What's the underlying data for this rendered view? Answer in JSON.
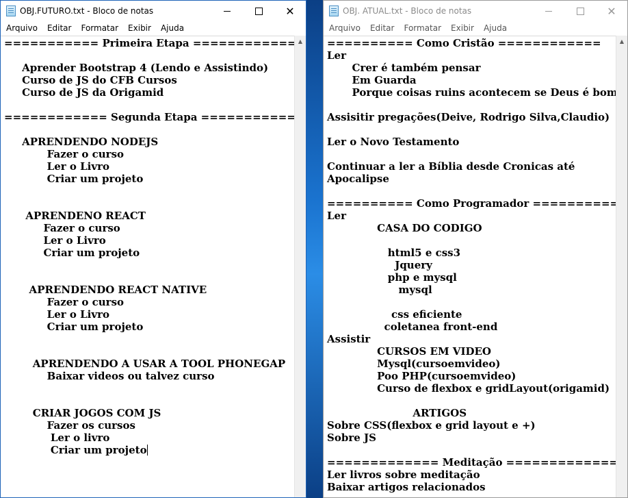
{
  "left_window": {
    "title": "OBJ.FUTURO.txt - Bloco de notas",
    "icon": "notepad-icon",
    "menu": [
      "Arquivo",
      "Editar",
      "Formatar",
      "Exibir",
      "Ajuda"
    ],
    "lines": [
      "=========== Primeira Etapa =============",
      "",
      "     Aprender Bootstrap 4 (Lendo e Assistindo)",
      "     Curso de JS do CFB Cursos",
      "     Curso de JS da Origamid",
      "",
      "============ Segunda Etapa =============",
      "",
      "     APRENDENDO NODEJS",
      "            Fazer o curso",
      "            Ler o Livro",
      "            Criar um projeto",
      "",
      "",
      "      APRENDENO REACT",
      "           Fazer o curso",
      "           Ler o Livro",
      "           Criar um projeto",
      "",
      "",
      "       APRENDENDO REACT NATIVE",
      "            Fazer o curso",
      "            Ler o Livro",
      "            Criar um projeto",
      "",
      "",
      "        APRENDENDO A USAR A TOOL PHONEGAP",
      "            Baixar videos ou talvez curso",
      "",
      "",
      "        CRIAR JOGOS COM JS",
      "            Fazer os cursos",
      "             Ler o livro",
      "             Criar um projeto"
    ]
  },
  "right_window": {
    "title": "OBJ. ATUAL.txt - Bloco de notas",
    "icon": "notepad-icon",
    "menu": [
      "Arquivo",
      "Editar",
      "Formatar",
      "Exibir",
      "Ajuda"
    ],
    "lines": [
      "========== Como Cristão ============",
      "Ler",
      "       Crer é também pensar",
      "       Em Guarda",
      "       Porque coisas ruins acontecem se Deus é bom",
      "",
      "Assisitir pregações(Deive, Rodrigo Silva,Claudio)",
      "",
      "Ler o Novo Testamento",
      "",
      "Continuar a ler a Bíblia desde Cronicas até",
      "Apocalipse",
      "",
      "========== Como Programador ============",
      "Ler",
      "              CASA DO CODIGO",
      "",
      "                 html5 e css3",
      "                   Jquery",
      "                 php e mysql",
      "                    mysql",
      "",
      "                  css eficiente",
      "                coletanea front-end",
      "Assistir",
      "              CURSOS EM VIDEO",
      "              Mysql(cursoemvideo)",
      "              Poo PHP(cursoemvideo)",
      "              Curso de flexbox e gridLayout(origamid)",
      "",
      "                        ARTIGOS",
      "Sobre CSS(flexbox e grid layout e +)",
      "Sobre JS",
      "",
      "============= Meditação ===============",
      "Ler livros sobre meditação",
      "Baixar artigos relacionados"
    ]
  }
}
